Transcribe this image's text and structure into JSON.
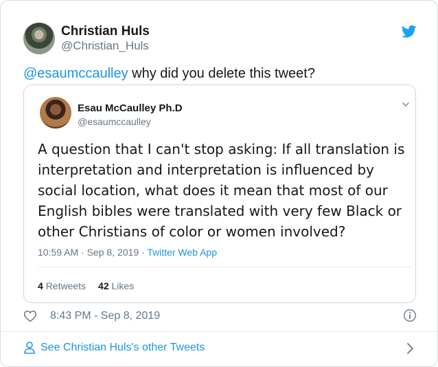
{
  "tweet": {
    "author_name": "Christian Huls",
    "author_handle": "@Christian_Huls",
    "mention": "@esaumccaulley",
    "text": " why did you delete this tweet?",
    "timestamp": "8:43 PM - Sep 8, 2019"
  },
  "quoted": {
    "author_name": "Esau McCaulley Ph.D",
    "author_handle": "@esaumccaulley",
    "text": "A question that I can't stop asking: If all translation is interpretation and interpretation is influenced by social location, what does it mean that most of our English bibles were translated with very few Black or other Christians of color or women involved?",
    "time": "10:59 AM · Sep 8, 2019 · ",
    "app": "Twitter Web App",
    "retweets_count": "4",
    "retweets_label": "Retweets",
    "likes_count": "42",
    "likes_label": "Likes"
  },
  "footer": {
    "see_more": "See Christian Huls's other Tweets"
  },
  "colors": {
    "accent": "#1b95e0",
    "muted": "#657786",
    "text": "#14171a",
    "border": "#ccd6dd"
  },
  "icons": [
    "twitter-logo-icon",
    "chevron-down-icon",
    "heart-icon",
    "info-icon",
    "person-icon",
    "chevron-right-icon"
  ]
}
